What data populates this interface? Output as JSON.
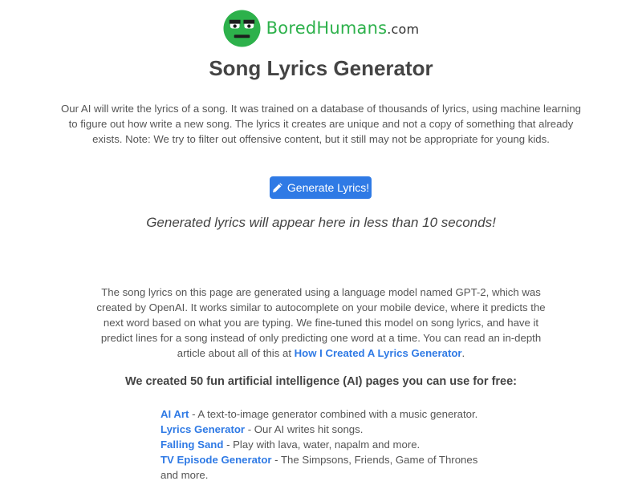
{
  "header": {
    "logo": {
      "name_bored": "Bored",
      "name_humans": "Humans",
      "domain": ".com"
    }
  },
  "page": {
    "title": "Song Lyrics Generator",
    "intro": "Our AI will write the lyrics of a song. It was trained on a database of thousands of lyrics, using machine learning to figure out how write a new song. The lyrics it creates are unique and not a copy of something that already exists. Note: We try to filter out offensive content, but it still may not be appropriate for young kids.",
    "generate_button_label": "Generate Lyrics!",
    "placeholder": "Generated lyrics will appear here in less than 10 seconds!",
    "about_text": "The song lyrics on this page are generated using a language model named GPT-2, which was created by OpenAI. It works similar to autocomplete on your mobile device, where it predicts the next word based on what you are typing. We fine-tuned this model on song lyrics, and have it predict lines for a song instead of only predicting one word at a time. You can read an in-depth article about all of this at ",
    "about_link": "How I Created A Lyrics Generator",
    "about_end": ".",
    "ai_pages_heading": "We created 50 fun artificial intelligence (AI) pages you can use for free:"
  },
  "ai_pages": [
    {
      "title": "AI Art",
      "description": " - A text-to-image generator combined with a music generator."
    },
    {
      "title": "Lyrics Generator",
      "description": " - Our AI writes hit songs."
    },
    {
      "title": "Falling Sand",
      "description": " - Play with lava, water, napalm and more."
    },
    {
      "title": "TV Episode Generator",
      "description": " - The Simpsons, Friends, Game of Thrones and more."
    }
  ],
  "icons": {
    "logo": "bored-face-icon",
    "button": "pencil-icon"
  },
  "colors": {
    "brand_green": "#2db14b",
    "link_blue": "#2f7ae5",
    "button_blue": "#2f7ae5"
  }
}
